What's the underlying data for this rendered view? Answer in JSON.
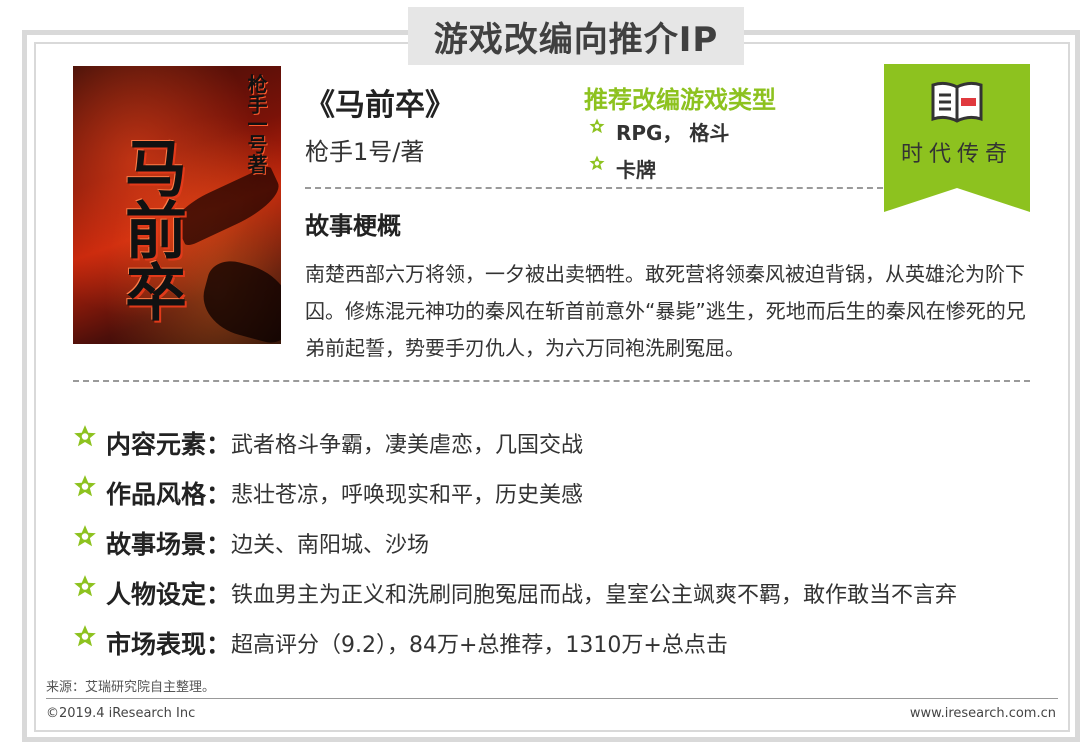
{
  "header": {
    "title": "游戏改编向推介IP"
  },
  "cover": {
    "title_vertical": "马前卒",
    "author_vertical": "枪手一号著"
  },
  "book": {
    "name": "《马前卒》",
    "author": "枪手1号/著"
  },
  "recommend": {
    "heading": "推荐改编游戏类型",
    "items": [
      "RPG， 格斗",
      "卡牌"
    ]
  },
  "badge": {
    "label": "时代传奇",
    "color": "#8dc21f"
  },
  "story": {
    "heading": "故事梗概",
    "text": "南楚西部六万将领，一夕被出卖牺牲。敢死营将领秦风被迫背锅，从英雄沦为阶下囚。修炼混元神功的秦风在斩首前意外“暴毙”逃生，死地而后生的秦风在惨死的兄弟前起誓，势要手刃仇人，为六万同袍洗刷冤屈。"
  },
  "attributes": [
    {
      "label": "内容元素：",
      "value": "武者格斗争霸，凄美虐恋，几国交战"
    },
    {
      "label": "作品风格：",
      "value": "悲壮苍凉，呼唤现实和平，历史美感"
    },
    {
      "label": "故事场景：",
      "value": "边关、南阳城、沙场"
    },
    {
      "label": "人物设定：",
      "value": "铁血男主为正义和洗刷同胞冤屈而战，皇室公主飒爽不羁，敢作敢当不言弃"
    },
    {
      "label": "市场表现：",
      "value": "超高评分（9.2），84万+总推荐，1310万+总点击"
    }
  ],
  "footer": {
    "source": "来源：艾瑞研究院自主整理。",
    "copyright": "©2019.4 iResearch Inc",
    "website": "www.iresearch.com.cn"
  },
  "colors": {
    "accent_green": "#8dc21f",
    "frame_gray": "#d9d9d9",
    "icon_red": "#e0393e"
  },
  "icons": {
    "badge_icon": "open-book-icon",
    "bullet_icon": "star-icon"
  }
}
